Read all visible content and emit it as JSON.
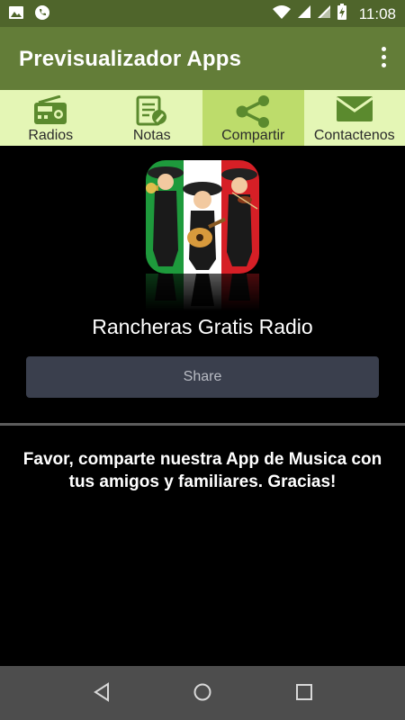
{
  "status_bar": {
    "time": "11:08",
    "icons": [
      "image-icon",
      "whatsapp-icon",
      "wifi-icon",
      "signal-icon",
      "signal-icon",
      "battery-charging-icon"
    ]
  },
  "app_bar": {
    "title": "Previsualizador Apps"
  },
  "tabs": [
    {
      "label": "Radios",
      "icon": "radio-icon",
      "active": false
    },
    {
      "label": "Notas",
      "icon": "notes-icon",
      "active": false
    },
    {
      "label": "Compartir",
      "icon": "share-icon",
      "active": true
    },
    {
      "label": "Contactenos",
      "icon": "mail-icon",
      "active": false
    }
  ],
  "content": {
    "app_name": "Rancheras Gratis Radio",
    "share_label": "Share",
    "message": "Favor, comparte nuestra App de Musica con tus amigos y familiares. Gracias!"
  },
  "colors": {
    "status_bar": "#4f652b",
    "app_bar": "#637d38",
    "tabs_bg": "#e4f6b5",
    "tab_active": "#bddc6b",
    "icon_green": "#5b8a2e",
    "share_button": "#3a3f4d"
  }
}
